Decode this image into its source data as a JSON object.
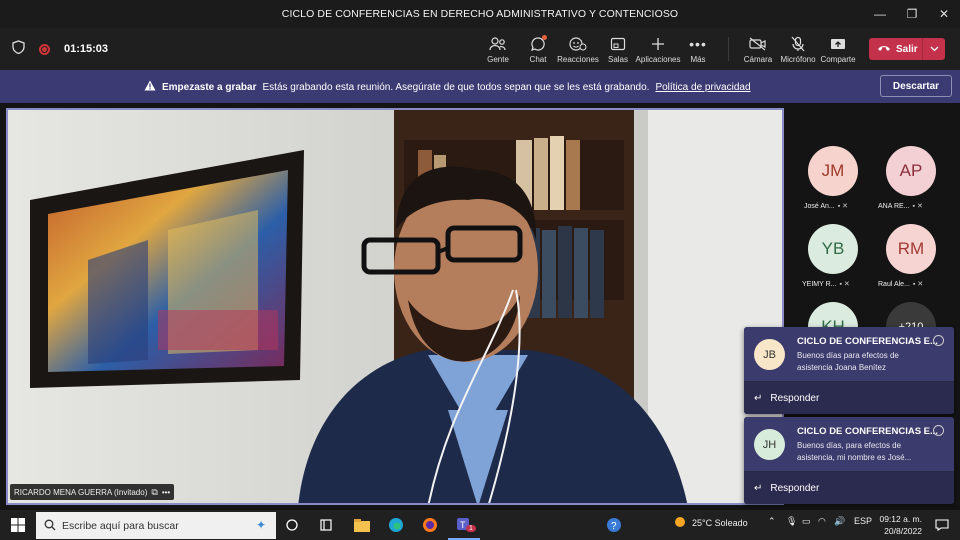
{
  "window": {
    "title": "CICLO DE CONFERENCIAS EN DERECHO ADMINISTRATIVO Y CONTENCIOSO"
  },
  "toolbar": {
    "timer": "01:15:03",
    "people": "Gente",
    "chat": "Chat",
    "reactions": "Reacciones",
    "rooms": "Salas",
    "apps": "Aplicaciones",
    "more": "Más",
    "camera": "Cámara",
    "mic": "Micrófono",
    "share": "Comparte",
    "leave": "Salir"
  },
  "banner": {
    "title": "Empezaste a grabar",
    "message": "Estás grabando esta reunión. Asegúrate de que todos sepan que se les está grabando.",
    "link": "Política de privacidad",
    "dismiss": "Descartar"
  },
  "main_video": {
    "name": "RICARDO MENA GUERRA (Invitado)"
  },
  "participants": [
    {
      "initials": "JM",
      "name": "José An...",
      "bg": "#f6d3cd",
      "fg": "#9f3a2b"
    },
    {
      "initials": "AP",
      "name": "ANA RE...",
      "bg": "#f2d0d4",
      "fg": "#8d2f3b"
    },
    {
      "initials": "YB",
      "name": "YEIMY R...",
      "bg": "#dcebe0",
      "fg": "#2f6b46"
    },
    {
      "initials": "RM",
      "name": "Raul Ale...",
      "bg": "#f6d4d2",
      "fg": "#a23b35"
    },
    {
      "initials": "KH",
      "name": "",
      "bg": "#dcebe0",
      "fg": "#2f6b46"
    },
    {
      "initials": "+210",
      "name": "",
      "bg": "#3a3a3a",
      "fg": "#ffffff"
    }
  ],
  "notifications": [
    {
      "initials": "JB",
      "bg": "#f7e6c8",
      "title": "CICLO DE CONFERENCIAS E...",
      "text": "Buenos días para efectos de asistencia Joana Benítez",
      "reply": "Responder"
    },
    {
      "initials": "JH",
      "bg": "#d8ecdc",
      "title": "CICLO DE CONFERENCIAS E...",
      "text": "Buenos días, para efectos de asistencia, mi nombre es José...",
      "reply": "Responder"
    }
  ],
  "taskbar": {
    "search_placeholder": "Escribe aquí para buscar",
    "weather": "25°C  Soleado",
    "lang": "ESP",
    "time": "09:12 a. m.",
    "date": "20/8/2022",
    "teams_badge": "1"
  },
  "colors": {
    "accent": "#6264a7",
    "leave": "#c4314b",
    "banner": "#3b3a72"
  }
}
